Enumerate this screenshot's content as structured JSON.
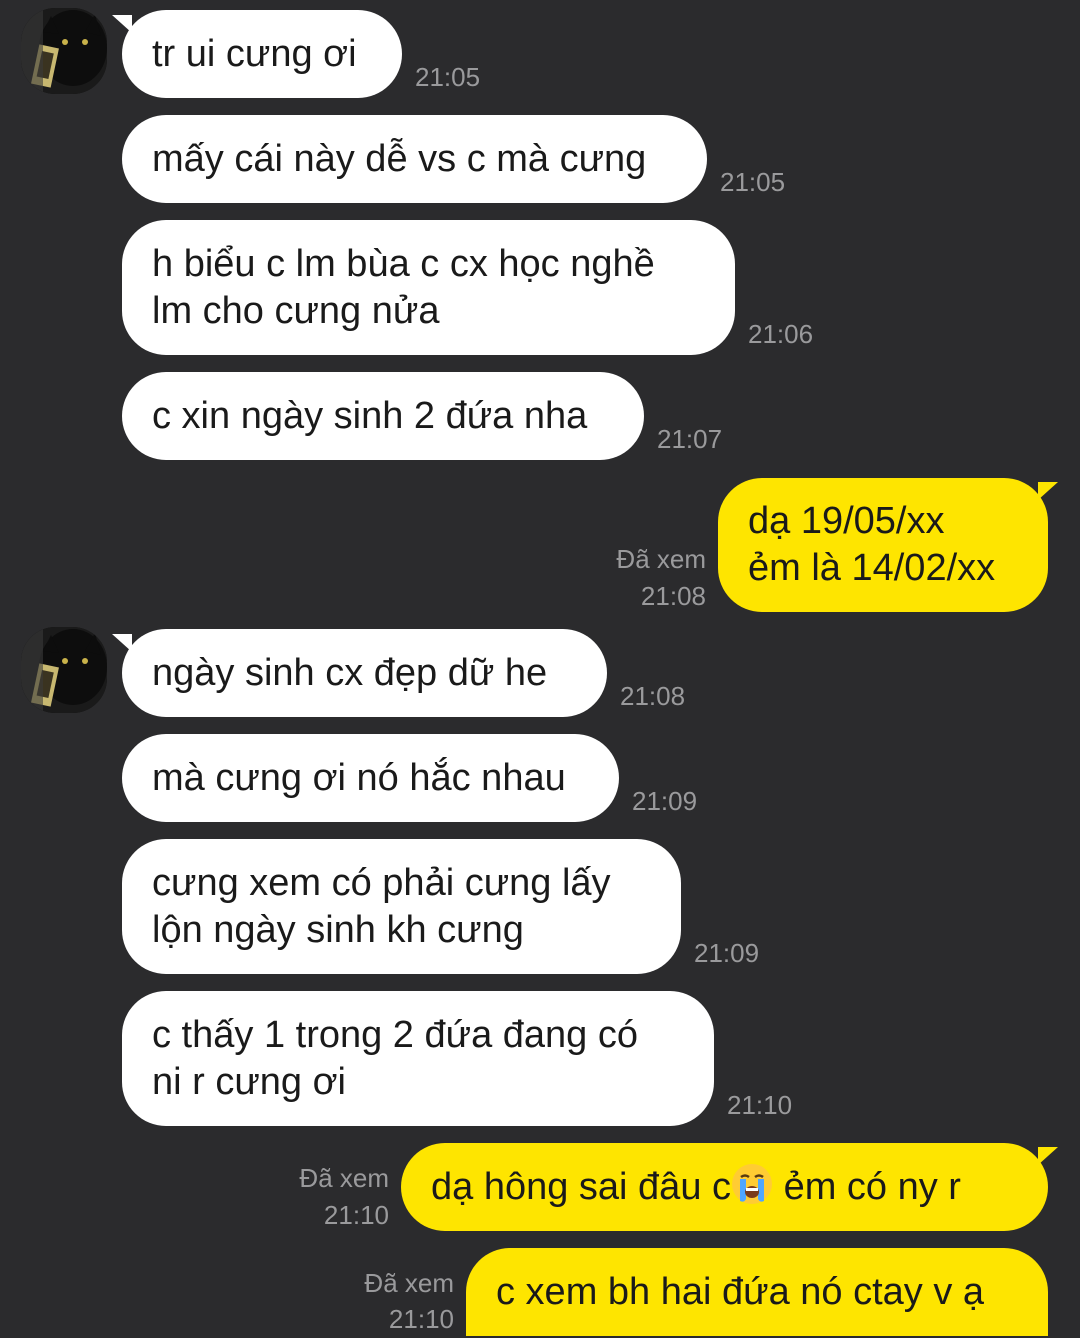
{
  "conversation": {
    "incoming_group_1": {
      "avatar_icon": "black-cat-avatar-icon",
      "messages": [
        {
          "lines": [
            "tr ui cưng ơi"
          ],
          "time": "21:05"
        },
        {
          "lines": [
            "mấy cái này dễ vs c mà cưng"
          ],
          "time": "21:05"
        },
        {
          "lines": [
            "h biểu c lm bùa c cx học nghề",
            "lm cho cưng nửa"
          ],
          "time": "21:06"
        },
        {
          "lines": [
            "c xin ngày sinh 2 đứa nha"
          ],
          "time": "21:07"
        }
      ]
    },
    "outgoing_1": {
      "lines": [
        "dạ 19/05/xx",
        "ẻm là 14/02/xx"
      ],
      "seen": "Đã xem",
      "time": "21:08"
    },
    "incoming_group_2": {
      "avatar_icon": "black-cat-avatar-icon",
      "messages": [
        {
          "lines": [
            "ngày sinh cx đẹp dữ he"
          ],
          "time": "21:08"
        },
        {
          "lines": [
            "mà cưng ơi nó hắc nhau"
          ],
          "time": "21:09"
        },
        {
          "lines": [
            "cưng xem có phải cưng lấy",
            "lộn ngày sinh kh cưng"
          ],
          "time": "21:09"
        },
        {
          "lines": [
            "c thấy 1 trong 2 đứa đang có",
            "ni r cưng ơi"
          ],
          "time": "21:10"
        }
      ]
    },
    "outgoing_2": {
      "text_before": "dạ hông sai đâu c",
      "emoji_icon": "loudly-crying-face-emoji-icon",
      "text_after": " ẻm có ny r",
      "seen": "Đã xem",
      "time": "21:10"
    },
    "outgoing_3": {
      "lines": [
        "c xem bh hai đứa nó ctay v ạ"
      ],
      "seen": "Đã xem",
      "time": "21:10"
    }
  },
  "colors": {
    "background": "#2b2b2d",
    "incoming_bubble": "#ffffff",
    "outgoing_bubble": "#fee500",
    "meta_text": "#9a9a9c"
  }
}
